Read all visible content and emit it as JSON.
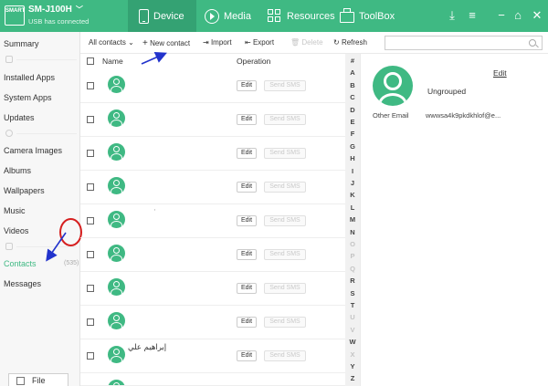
{
  "device": {
    "logo_text": "SMART",
    "name": "SM-J100H",
    "status": "USB has connected"
  },
  "nav": {
    "tabs": [
      {
        "label": "Device",
        "icon": "device-icon"
      },
      {
        "label": "Media",
        "icon": "media-icon"
      },
      {
        "label": "Resources",
        "icon": "resources-icon"
      },
      {
        "label": "ToolBox",
        "icon": "toolbox-icon"
      }
    ],
    "active": "Device"
  },
  "window_buttons": {
    "download": "⤓",
    "menu": "≡",
    "minimize": "−",
    "home": "⌂",
    "close": "✕"
  },
  "sidebar": {
    "items": [
      "Summary",
      "Installed Apps",
      "System Apps",
      "Updates",
      "Camera Images",
      "Albums",
      "Wallpapers",
      "Music",
      "Videos",
      "Contacts",
      "Messages"
    ],
    "active": "Contacts",
    "contacts_count": "(535)",
    "file_button": "File"
  },
  "toolbar": {
    "all_contacts": "All contacts",
    "new_contact": "New contact",
    "import": "Import",
    "export": "Export",
    "delete": "Delete",
    "refresh": "Refresh",
    "search_placeholder": ""
  },
  "list": {
    "header_name": "Name",
    "header_operation": "Operation",
    "edit_label": "Edit",
    "sms_label": "Send SMS",
    "rows": [
      {
        "name": ""
      },
      {
        "name": ""
      },
      {
        "name": ""
      },
      {
        "name": ""
      },
      {
        "name": "·"
      },
      {
        "name": ""
      },
      {
        "name": ""
      },
      {
        "name": ""
      },
      {
        "name": "إبراهيم علي"
      },
      {
        "name": ""
      }
    ]
  },
  "alphabet": {
    "letters": [
      "#",
      "A",
      "B",
      "C",
      "D",
      "E",
      "F",
      "G",
      "H",
      "I",
      "J",
      "K",
      "L",
      "M",
      "N",
      "O",
      "P",
      "Q",
      "R",
      "S",
      "T",
      "U",
      "V",
      "W",
      "X",
      "Y",
      "Z"
    ],
    "dimmed": [
      "O",
      "P",
      "Q",
      "U",
      "V",
      "X"
    ]
  },
  "detail": {
    "edit_label": "Edit",
    "group": "Ungrouped",
    "email_label": "Other Email",
    "email_value": "wwwsa4k9pkdkhlof@e..."
  },
  "colors": {
    "accent": "#3fb983",
    "annotation_arrow": "#2233cc",
    "annotation_ring": "#d61f1f"
  }
}
